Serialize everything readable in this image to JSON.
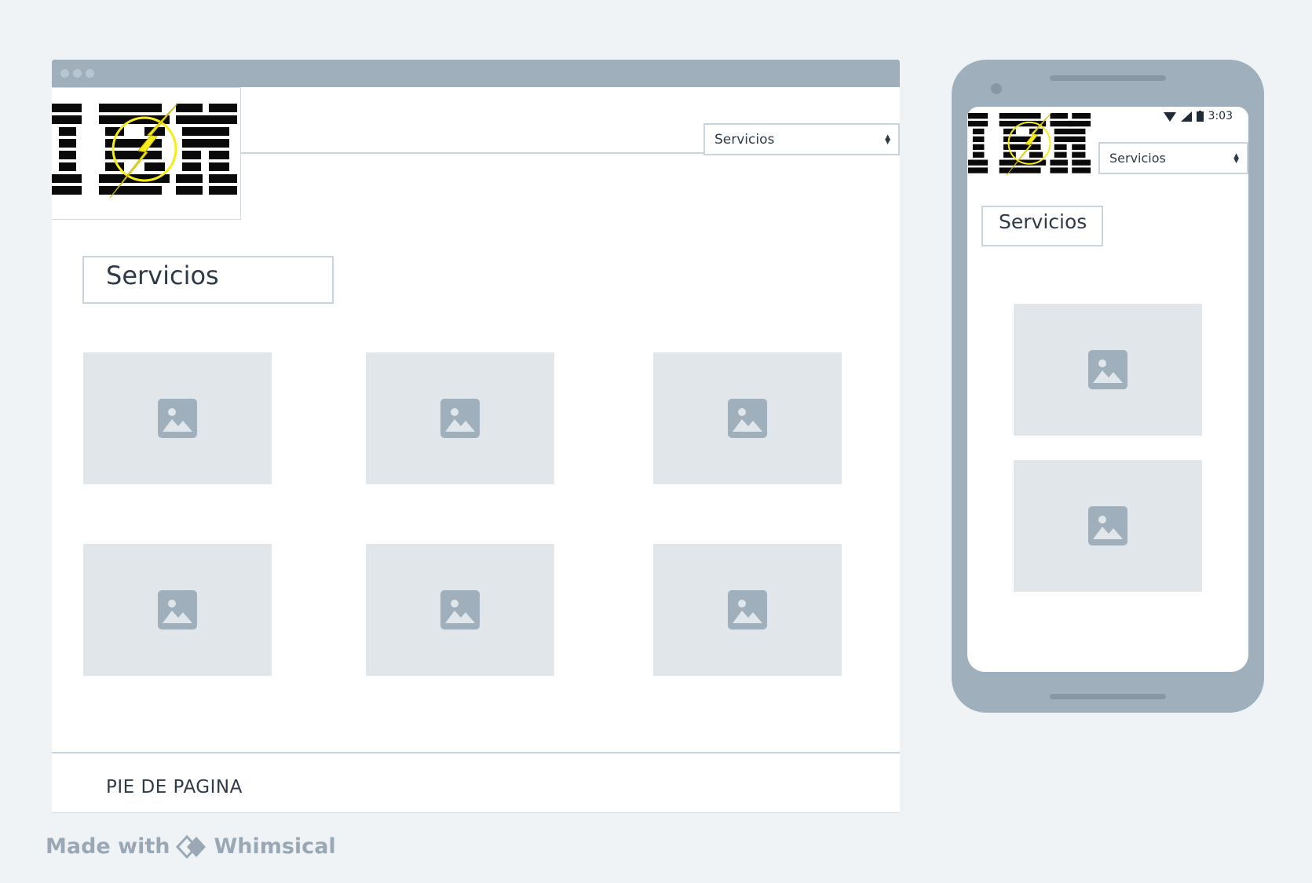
{
  "desktop": {
    "header": {
      "select_value": "Servicios"
    },
    "page_title": "Servicios",
    "images": [
      "image-placeholder",
      "image-placeholder",
      "image-placeholder",
      "image-placeholder",
      "image-placeholder",
      "image-placeholder"
    ],
    "footer": "PIE DE PAGINA"
  },
  "mobile": {
    "status_time": "3:03",
    "select_value": "Servicios",
    "page_title": "Servicios",
    "images": [
      "image-placeholder",
      "image-placeholder"
    ]
  },
  "watermark": {
    "prefix": "Made with",
    "brand": "Whimsical"
  },
  "colors": {
    "background": "#eff3f6",
    "frame": "#9fafbc",
    "placeholder": "#e1e6eb",
    "placeholder_icon": "#9fafbc",
    "border": "#c9d3dc",
    "logo_bolt": "#f5ec19"
  },
  "icons": [
    "image-icon",
    "wifi-icon",
    "signal-icon",
    "battery-icon",
    "whimsical-logo-icon",
    "select-arrows-icon"
  ]
}
